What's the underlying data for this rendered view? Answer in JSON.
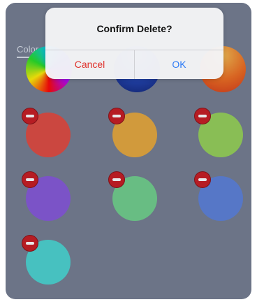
{
  "tab": {
    "label": "Color"
  },
  "alert": {
    "title": "Confirm Delete?",
    "cancel_label": "Cancel",
    "ok_label": "OK"
  },
  "wheels": [
    "color-wheel-rainbow",
    "color-wheel-blue",
    "color-wheel-orange"
  ],
  "swatches": [
    {
      "name": "red",
      "color": "#e0483e"
    },
    {
      "name": "orange",
      "color": "#e6a73a"
    },
    {
      "name": "lime",
      "color": "#95d056"
    },
    {
      "name": "purple",
      "color": "#8456d8"
    },
    {
      "name": "mint",
      "color": "#6fcf8a"
    },
    {
      "name": "blue",
      "color": "#5a7fd8"
    },
    {
      "name": "teal",
      "color": "#49d3d0"
    }
  ],
  "colors": {
    "panel": "#737c8f",
    "delete_badge": "#c8171d",
    "cancel_text": "#e0312b",
    "ok_text": "#2f7cf6"
  }
}
